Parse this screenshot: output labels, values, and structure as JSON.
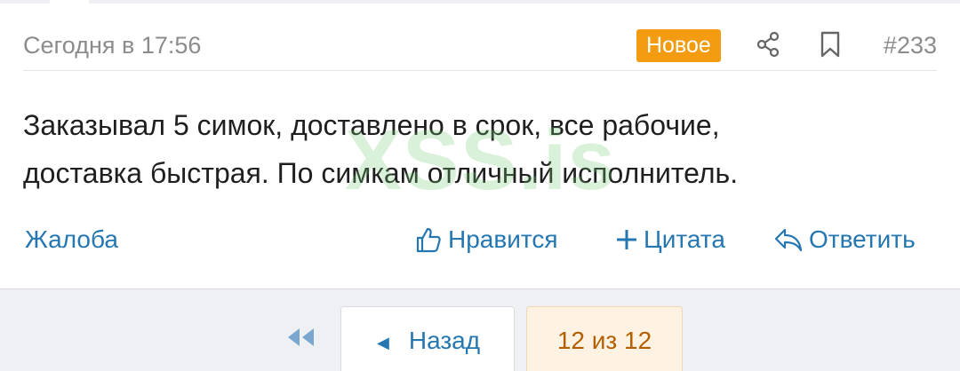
{
  "post": {
    "date": "Сегодня в 17:56",
    "badge": "Новое",
    "number": "#233",
    "message_line1": "Заказывал 5 симок, доставлено в срок, все рабочие,",
    "message_line2": "доставка быстрая. По симкам отличный исполнитель.",
    "watermark": "XSS.is"
  },
  "actions": {
    "report": "Жалоба",
    "like": "Нравится",
    "quote": "Цитата",
    "reply": "Ответить"
  },
  "pagination": {
    "back": "Назад",
    "indicator": "12 из 12"
  },
  "colors": {
    "link": "#2577b1",
    "badge": "#f39c12",
    "page_indicator_bg": "#fef3e2",
    "page_indicator_text": "#b35f00"
  }
}
